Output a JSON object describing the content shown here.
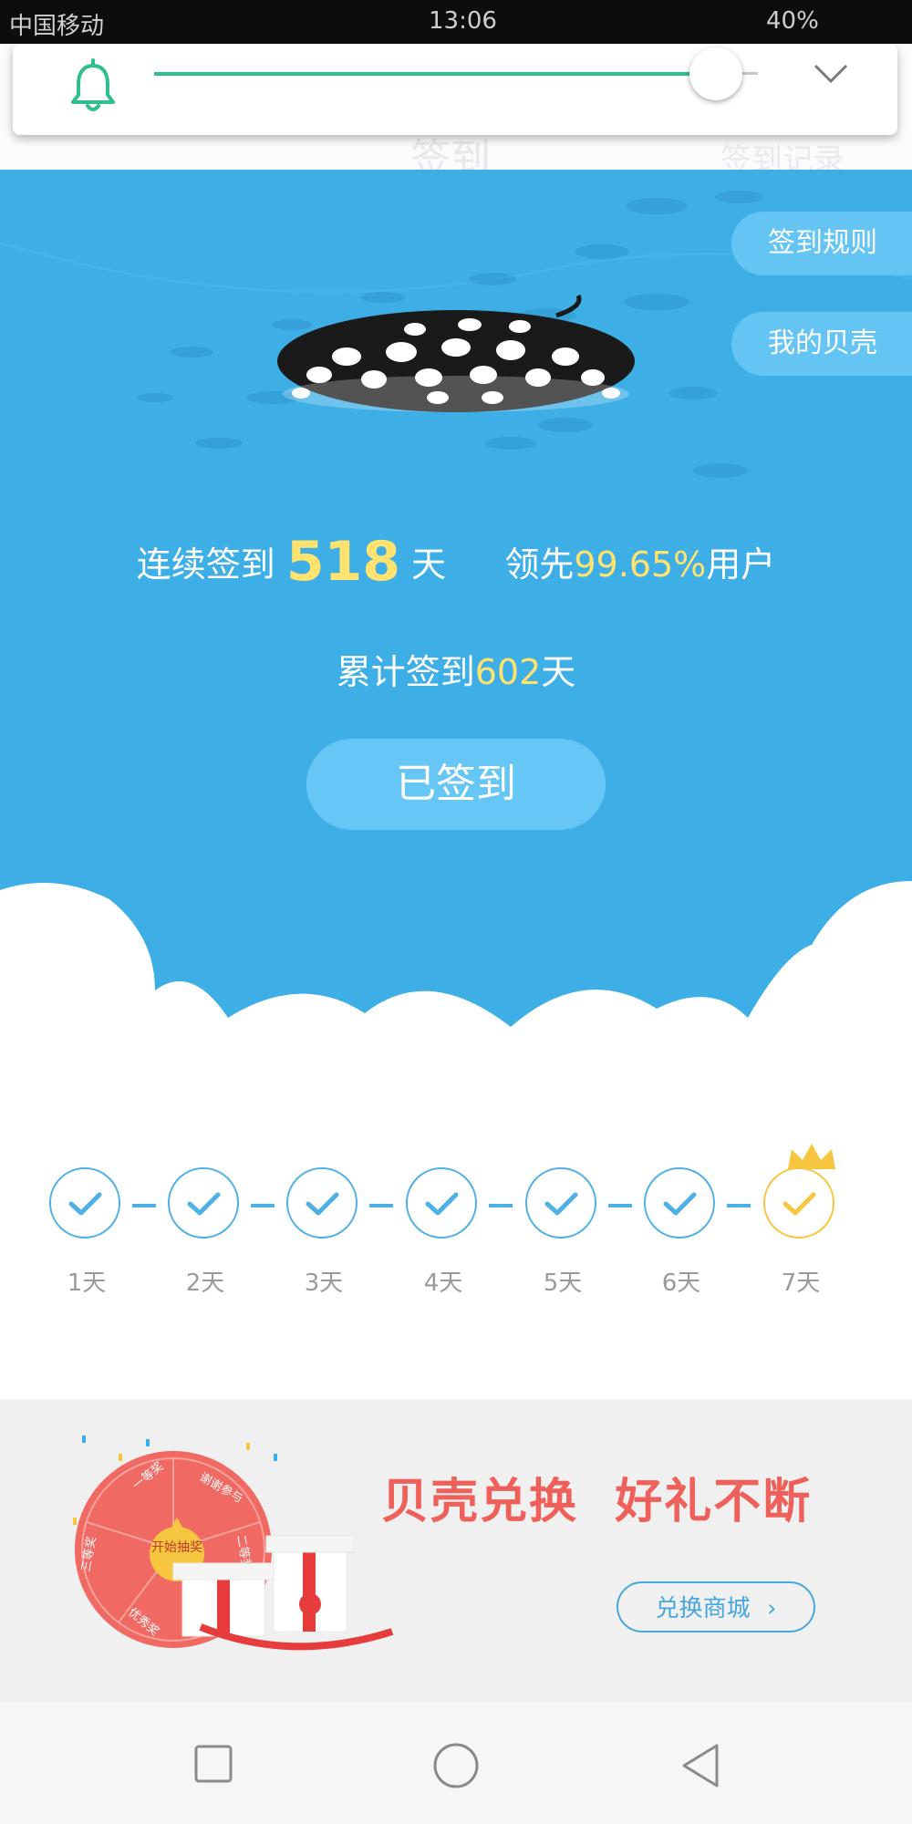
{
  "status_bar": {
    "carrier": "中国移动",
    "time": "13:06",
    "battery": "40%"
  },
  "header": {
    "title": "签到",
    "right_link": "签到记录"
  },
  "notification": {
    "bell_icon": "bell-icon",
    "expand_icon": "chevron-down-icon"
  },
  "hero": {
    "rule_button": "签到规则",
    "shell_button": "我的贝壳",
    "streak_prefix": "连续签到",
    "streak_days": "518",
    "streak_unit": "天",
    "lead_prefix": "领先",
    "lead_percent": "99.65%",
    "lead_suffix": "用户",
    "total_prefix": "累计签到",
    "total_days": "602",
    "total_unit": "天",
    "signed_button": "已签到"
  },
  "week": {
    "days": [
      {
        "label": "1天",
        "checked": true
      },
      {
        "label": "2天",
        "checked": true
      },
      {
        "label": "3天",
        "checked": true
      },
      {
        "label": "4天",
        "checked": true
      },
      {
        "label": "5天",
        "checked": true
      },
      {
        "label": "6天",
        "checked": true
      },
      {
        "label": "7天",
        "checked": true,
        "crown": true
      }
    ]
  },
  "banner": {
    "title": "贝壳兑换  好礼不断",
    "mall_button": "兑换商城",
    "wheel_center": "开始抽奖",
    "wheel_labels": [
      "一等奖",
      "谢谢参与",
      "二等奖",
      "三等奖",
      "优秀奖"
    ]
  },
  "colors": {
    "hero_bg": "#3eaee6",
    "accent_gold": "#ffe36e",
    "check_blue": "#4eb0e5",
    "crown_gold": "#f6c640",
    "banner_red": "#f0605a"
  }
}
